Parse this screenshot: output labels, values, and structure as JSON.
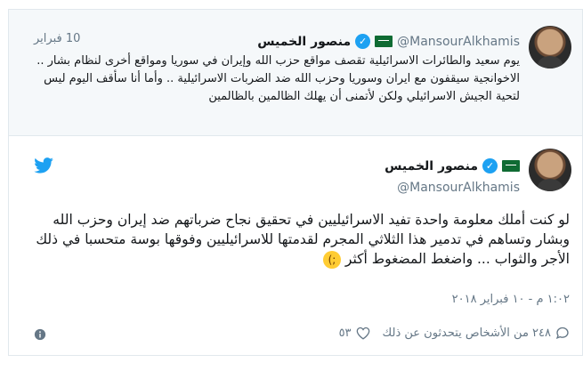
{
  "quoted_tweet": {
    "author_name": "منصور الخميس",
    "handle": "@MansourAlkhamis",
    "date": "10 فبراير",
    "text": "يوم سعيد والطائرات الاسرائيلية تقصف مواقع حزب الله وإيران في سوريا ومواقع أخرى لنظام بشار .. الاخوانجية سيقفون مع ايران وسوريا وحزب الله ضد الضربات الاسرائيلية .. وأما أنا سأقف اليوم ليس لتحية الجيش الاسرائيلي ولكن لأتمنى أن يهلك الظالمين بالظالمين"
  },
  "main_tweet": {
    "author_name": "منصور الخميس",
    "handle": "@MansourAlkhamis",
    "text": "لو كنت أملك معلومة واحدة تفيد الاسرائيليين في تحقيق نجاح ضرباتهم ضد إيران وحزب الله وبشار وتساهم في تدمير هذا الثلاثي المجرم لقدمتها للاسرائيليين وفوقها بوسة متحسبا في ذلك الأجر والثواب ... واضغط المضغوط أكثر",
    "timestamp": "١:٠٢ م - ١٠ فبراير ٢٠١٨",
    "likes": "٥٣",
    "replies_text": "٢٤٨ من الأشخاص يتحدثون عن ذلك"
  },
  "icons": {
    "verified": "verified-badge-icon",
    "flag": "saudi-flag-icon",
    "bird": "twitter-bird-icon",
    "heart": "heart-icon",
    "reply": "reply-bubble-icon",
    "info": "info-icon",
    "emoji": "winking-face-emoji"
  },
  "colors": {
    "accent": "#1da1f2",
    "muted": "#657786",
    "quoted_bg": "#f5f8fa",
    "border": "#e1e8ed"
  }
}
